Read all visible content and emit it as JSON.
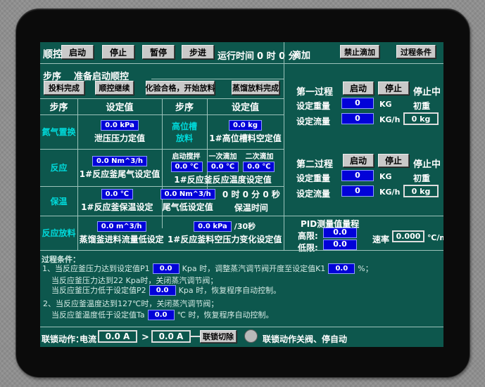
{
  "colors": {
    "screen_bg": "#0d574d",
    "value_blue": "#0202d8",
    "cyan_text": "#00dadb",
    "button_gray": "#c9c9c9",
    "grid_line": "#9cc2ba"
  },
  "top_bar": {
    "title": "顺控",
    "btn_start": "启动",
    "btn_stop": "停止",
    "btn_pause": "暂停",
    "btn_step": "步进",
    "runtime_label": "运行时间",
    "runtime_value": "0 时 0 分"
  },
  "step_row": {
    "label": "步序",
    "value": "准备启动顺控"
  },
  "action_buttons": {
    "feed_done": "投料完成",
    "seq_continue": "顺控继续",
    "test_ok": "化验合格，开始放料",
    "dist_done": "蒸馏放料完成"
  },
  "table": {
    "headers": {
      "h1": "步序",
      "h2": "设定值",
      "h3": "步序",
      "h4": "设定值"
    },
    "rows": {
      "r1": {
        "step": "氮气置换",
        "value": "0.0 kPa",
        "caption": "泄压压力定值",
        "step2_line1": "高位槽",
        "step2_line2": "放料",
        "value2": "0.0 kg",
        "caption2": "1#高位槽料空定值"
      },
      "r2": {
        "step": "反应",
        "value": "0.0 Nm^3/h",
        "caption": "1#反应釜尾气设定值",
        "t1_label": "启动搅拌",
        "t2_label": "一次滴加",
        "t3_label": "二次滴加",
        "t1": "0.0 ℃",
        "t2": "0.0 ℃",
        "t3": "0.0 ℃",
        "caption2": "1#反应釜反应温度设定值"
      },
      "r3": {
        "step": "保温",
        "value": "0.0 ℃",
        "caption": "1#反应釜保温设定",
        "value2": "0.0 Nm^3/h",
        "caption2": "尾气低设定值",
        "time": "0 时 0 分 0 秒",
        "time_caption": "保温时间"
      },
      "r4": {
        "step": "反应放料",
        "value": "0.0 m^3/h",
        "caption": "蒸馏釜进料流量低设定",
        "value2": "0.0 kPa",
        "suffix": "/30秒",
        "caption2": "1#反应釜料空压力变化设定值"
      }
    }
  },
  "dripping": {
    "title": "滴加",
    "btn_forbid": "禁止滴加",
    "btn_conditions": "过程条件"
  },
  "process1": {
    "title": "第一过程",
    "btn_start": "启动",
    "btn_stop": "停止",
    "status": "停止中",
    "weight_label": "设定重量",
    "weight_value": "0",
    "weight_unit": "KG",
    "init_label": "初重",
    "flow_label": "设定流量",
    "flow_value": "0",
    "flow_unit": "KG/h",
    "init_value": "0 kg"
  },
  "process2": {
    "title": "第二过程",
    "btn_start": "启动",
    "btn_stop": "停止",
    "status": "停止中",
    "weight_label": "设定重量",
    "weight_value": "0",
    "weight_unit": "KG",
    "init_label": "初重",
    "flow_label": "设定流量",
    "flow_value": "0",
    "flow_unit": "KG/h",
    "init_value": "0 kg"
  },
  "pid": {
    "title": "PID测量值量程",
    "high_label": "高限:",
    "high_value": "0.0",
    "low_label": "低限:",
    "low_value": "0.0",
    "rate_label": "速率",
    "rate_value": "0.000",
    "rate_unit": "℃/m"
  },
  "conditions": {
    "title": "过程条件：",
    "l1_pre": "1、当反应釜压力达到设定值P1",
    "l1_v1": "0.0",
    "l1_mid": "Kpa 时，调整蒸汽调节阀开度至设定值K1",
    "l1_v2": "0.0",
    "l1_post": "%；",
    "l2": "当反应釜压力达到22 Kpa时，关闭蒸汽调节阀；",
    "l3_pre": "当反应釜压力低于设定值P2",
    "l3_v": "0.0",
    "l3_post": "Kpa 时，恢复程序自动控制。",
    "l4": "2、当反应釜温度达到127℃时，关闭蒸汽调节阀；",
    "l5_pre": "当反应釜温度低于设定值Ta",
    "l5_v": "0.0",
    "l5_post": "℃ 时，恢复程序自动控制。"
  },
  "interlock": {
    "label": "联锁动作：",
    "current_label": "电流",
    "measured": "0.0 A",
    "gt": ">",
    "limit": "0.0 A",
    "btn_cut": "联锁切除",
    "lamp_caption": "联锁动作关阀、停自动"
  }
}
